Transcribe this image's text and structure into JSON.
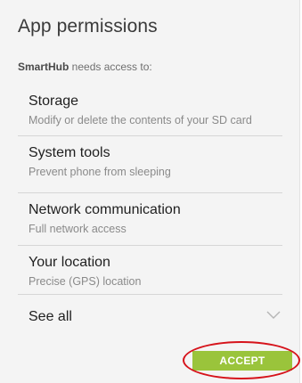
{
  "dialog": {
    "title": "App permissions",
    "subtitle_app": "SmartHub",
    "subtitle_rest": " needs access to:"
  },
  "permissions": [
    {
      "name": "Storage",
      "desc": "Modify or delete the contents of your SD card"
    },
    {
      "name": "System tools",
      "desc": "Prevent phone from sleeping"
    },
    {
      "name": "Network communication",
      "desc": "Full network access"
    },
    {
      "name": "Your location",
      "desc": "Precise (GPS) location"
    }
  ],
  "see_all": {
    "label": "See all",
    "icon": "chevron-down-icon"
  },
  "accept": {
    "label": "ACCEPT",
    "color": "#9ac43b"
  },
  "highlight": {
    "color": "#d6131b"
  }
}
